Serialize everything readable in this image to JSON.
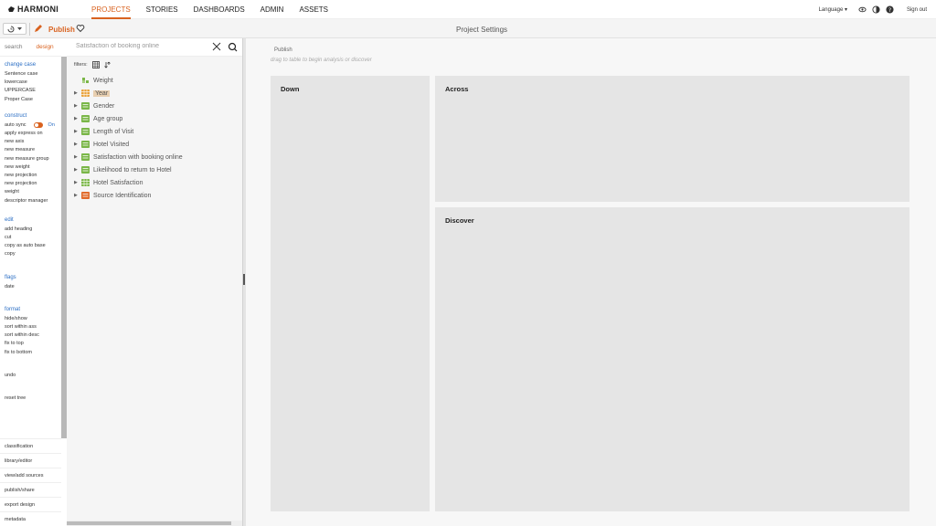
{
  "app": {
    "logo": "HARMONI"
  },
  "nav": {
    "links": [
      "PROJECTS",
      "STORIES",
      "DASHBOARDS",
      "ADMIN",
      "ASSETS"
    ],
    "active": "PROJECTS",
    "language": "Language ▾",
    "signout": "Sign out"
  },
  "toolbar": {
    "publish": "Publish",
    "page_title": "Project Settings"
  },
  "sidebar": {
    "tabs": {
      "search": "search",
      "design": "design"
    },
    "sections": [
      {
        "heading": "change case",
        "items": [
          "Sentence case",
          "lowercase",
          "UPPERCASE",
          "Proper Case"
        ]
      },
      {
        "heading": "construct",
        "autosync": {
          "label": "auto sync",
          "state": "On"
        },
        "items": [
          "apply express on",
          "new axis",
          "new measure",
          "new measure group",
          "new weight",
          "new projection",
          "new projection",
          "weight",
          "descriptor manager"
        ]
      },
      {
        "heading": "edit",
        "items": [
          "add heading",
          "cut",
          "copy as auto base",
          "copy"
        ]
      },
      {
        "heading": "flags",
        "items": [
          "date"
        ]
      },
      {
        "heading": "format",
        "items": [
          "hide/show",
          "sort within ass",
          "sort within desc",
          "fix to top",
          "fix to bottom"
        ]
      },
      {
        "heading": "",
        "items": [
          "undo"
        ]
      },
      {
        "heading": "",
        "items": [
          "reset tree"
        ]
      }
    ],
    "bottom": [
      "classification",
      "library/editor",
      "view/add sources",
      "publish/share",
      "export design",
      "metadata"
    ]
  },
  "search": {
    "value": "Satisfaction of booking online"
  },
  "tree": {
    "filters_label": "filters:",
    "items": [
      {
        "label": "Weight",
        "icon": "weight-icon",
        "color": "#7ab648",
        "has_arrow": false,
        "selected": false
      },
      {
        "label": "Year",
        "icon": "grid-icon",
        "color": "#e9a23b",
        "has_arrow": true,
        "selected": true
      },
      {
        "label": "Gender",
        "icon": "list-icon",
        "color": "#7ab648",
        "has_arrow": true,
        "selected": false
      },
      {
        "label": "Age group",
        "icon": "list-icon",
        "color": "#7ab648",
        "has_arrow": true,
        "selected": false
      },
      {
        "label": "Length of Visit",
        "icon": "list-icon",
        "color": "#7ab648",
        "has_arrow": true,
        "selected": false
      },
      {
        "label": "Hotel Visited",
        "icon": "list-icon",
        "color": "#7ab648",
        "has_arrow": true,
        "selected": false
      },
      {
        "label": "Satisfaction with booking online",
        "icon": "list-icon",
        "color": "#7ab648",
        "has_arrow": true,
        "selected": false
      },
      {
        "label": "Likelihood to return to Hotel",
        "icon": "list-icon",
        "color": "#7ab648",
        "has_arrow": true,
        "selected": false
      },
      {
        "label": "Hotel Satisfaction",
        "icon": "grid-icon",
        "color": "#7ab648",
        "has_arrow": true,
        "selected": false
      },
      {
        "label": "Source Identification",
        "icon": "list-icon",
        "color": "#e06a2b",
        "has_arrow": true,
        "selected": false
      }
    ]
  },
  "canvas": {
    "publish_label": "Publish",
    "hint": "drag to table to begin analysis or discover",
    "zones": {
      "down": "Down",
      "across": "Across",
      "discover": "Discover"
    }
  },
  "colors": {
    "accent": "#d9621f",
    "link": "#2a6ec4"
  }
}
